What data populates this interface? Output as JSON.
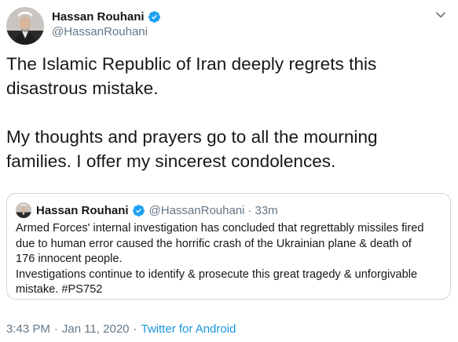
{
  "tweet": {
    "author": {
      "display_name": "Hassan Rouhani",
      "handle": "@HassanRouhani",
      "avatar_icon": "user-avatar-photo",
      "verified": true
    },
    "text": "The Islamic Republic of Iran deeply regrets this\ndisastrous mistake.\n\nMy thoughts and prayers go to all the mourning\nfamilies. I offer my sincerest condolences.",
    "quoted": {
      "display_name": "Hassan Rouhani",
      "handle": "@HassanRouhani",
      "separator": "·",
      "time": "33m",
      "text": "Armed Forces' internal investigation has concluded that regrettably missiles fired\ndue to human error caused the horrific crash of the Ukrainian plane & death of\n176 innocent people.\nInvestigations continue to identify & prosecute this great tragedy & unforgivable\nmistake. #PS752"
    },
    "meta": {
      "time": "3:43 PM",
      "separator": "·",
      "date": "Jan 11, 2020",
      "source": "Twitter for Android"
    }
  },
  "colors": {
    "text_primary": "#14171a",
    "text_secondary": "#657786",
    "verified_blue": "#1da1f2",
    "link_blue": "#1b95e0",
    "border": "#ccd6dd"
  }
}
